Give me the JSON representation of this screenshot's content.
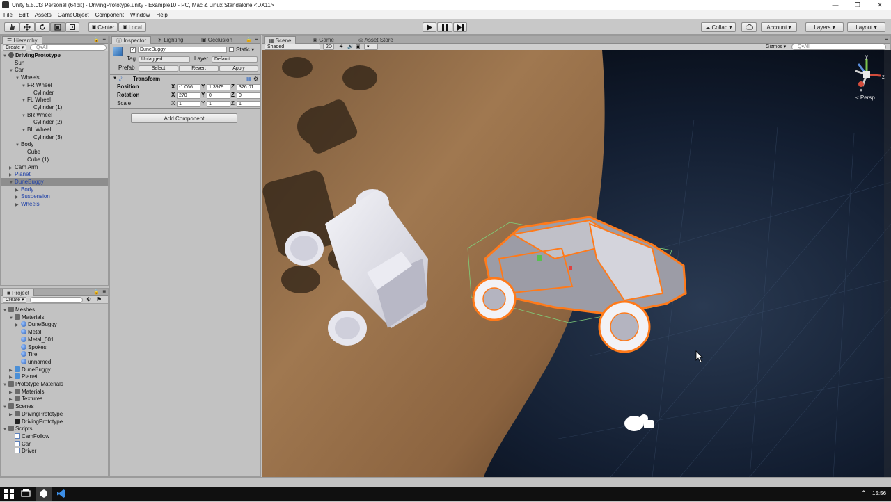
{
  "window": {
    "title": "Unity 5.5.0f3 Personal (64bit) - DrivingPrototype.unity - Example10 - PC, Mac & Linux Standalone <DX11>",
    "controls": [
      "—",
      "❐",
      "✕"
    ]
  },
  "menu": [
    "File",
    "Edit",
    "Assets",
    "GameObject",
    "Component",
    "Window",
    "Help"
  ],
  "toolbar": {
    "pivot": "Center",
    "space": "Local",
    "collab": "Collab ▾",
    "account": "Account ▾",
    "layers": "Layers ▾",
    "layout": "Layout ▾"
  },
  "hierarchy": {
    "tab": "Hierarchy",
    "create": "Create ▾",
    "search_placeholder": "Q▾All",
    "items": [
      {
        "label": "DrivingPrototype",
        "level": 0,
        "arrow": "▼",
        "style": "bold"
      },
      {
        "label": "Sun",
        "level": 1,
        "arrow": "",
        "style": ""
      },
      {
        "label": "Car",
        "level": 1,
        "arrow": "▼",
        "style": ""
      },
      {
        "label": "Wheels",
        "level": 2,
        "arrow": "▼",
        "style": ""
      },
      {
        "label": "FR Wheel",
        "level": 3,
        "arrow": "▼",
        "style": ""
      },
      {
        "label": "Cylinder",
        "level": 4,
        "arrow": "",
        "style": ""
      },
      {
        "label": "FL Wheel",
        "level": 3,
        "arrow": "▼",
        "style": ""
      },
      {
        "label": "Cylinder (1)",
        "level": 4,
        "arrow": "",
        "style": ""
      },
      {
        "label": "BR Wheel",
        "level": 3,
        "arrow": "▼",
        "style": ""
      },
      {
        "label": "Cylinder (2)",
        "level": 4,
        "arrow": "",
        "style": ""
      },
      {
        "label": "BL Wheel",
        "level": 3,
        "arrow": "▼",
        "style": ""
      },
      {
        "label": "Cylinder (3)",
        "level": 4,
        "arrow": "",
        "style": ""
      },
      {
        "label": "Body",
        "level": 2,
        "arrow": "▼",
        "style": ""
      },
      {
        "label": "Cube",
        "level": 3,
        "arrow": "",
        "style": ""
      },
      {
        "label": "Cube (1)",
        "level": 3,
        "arrow": "",
        "style": ""
      },
      {
        "label": "Cam Arm",
        "level": 1,
        "arrow": "▶",
        "style": ""
      },
      {
        "label": "Planet",
        "level": 1,
        "arrow": "▶",
        "style": "blue"
      },
      {
        "label": "DuneBuggy",
        "level": 1,
        "arrow": "▼",
        "style": "selected"
      },
      {
        "label": "Body",
        "level": 2,
        "arrow": "▶",
        "style": "blue"
      },
      {
        "label": "Suspension",
        "level": 2,
        "arrow": "▶",
        "style": "blue"
      },
      {
        "label": "Wheels",
        "level": 2,
        "arrow": "▶",
        "style": "blue"
      }
    ]
  },
  "project": {
    "tab": "Project",
    "create": "Create ▾",
    "items": [
      {
        "label": "Meshes",
        "level": 0,
        "arrow": "▼",
        "icon": "folder"
      },
      {
        "label": "Materials",
        "level": 1,
        "arrow": "▼",
        "icon": "folder"
      },
      {
        "label": "DuneBuggy",
        "level": 2,
        "arrow": "▶",
        "icon": "sphere"
      },
      {
        "label": "Metal",
        "level": 2,
        "arrow": "",
        "icon": "sphere"
      },
      {
        "label": "Metal_001",
        "level": 2,
        "arrow": "",
        "icon": "sphere"
      },
      {
        "label": "Spokes",
        "level": 2,
        "arrow": "",
        "icon": "sphere"
      },
      {
        "label": "Tire",
        "level": 2,
        "arrow": "",
        "icon": "sphere"
      },
      {
        "label": "unnamed",
        "level": 2,
        "arrow": "",
        "icon": "sphere"
      },
      {
        "label": "DuneBuggy",
        "level": 1,
        "arrow": "▶",
        "icon": "prefab"
      },
      {
        "label": "Planet",
        "level": 1,
        "arrow": "▶",
        "icon": "prefab"
      },
      {
        "label": "Prototype Materials",
        "level": 0,
        "arrow": "▼",
        "icon": "folder"
      },
      {
        "label": "Materials",
        "level": 1,
        "arrow": "▶",
        "icon": "folder"
      },
      {
        "label": "Textures",
        "level": 1,
        "arrow": "▶",
        "icon": "folder"
      },
      {
        "label": "Scenes",
        "level": 0,
        "arrow": "▼",
        "icon": "folder"
      },
      {
        "label": "DrivingPrototype",
        "level": 1,
        "arrow": "▶",
        "icon": "folder"
      },
      {
        "label": "DrivingPrototype",
        "level": 1,
        "arrow": "",
        "icon": "scene"
      },
      {
        "label": "Scripts",
        "level": 0,
        "arrow": "▼",
        "icon": "folder"
      },
      {
        "label": "CamFollow",
        "level": 1,
        "arrow": "",
        "icon": "script"
      },
      {
        "label": "Car",
        "level": 1,
        "arrow": "",
        "icon": "script"
      },
      {
        "label": "Driver",
        "level": 1,
        "arrow": "",
        "icon": "script"
      }
    ]
  },
  "inspector": {
    "tabs": [
      "Inspector",
      "Lighting",
      "Occlusion"
    ],
    "object_name": "DuneBuggy",
    "static_label": "Static ▾",
    "tag_label": "Tag",
    "tag_value": "Untagged",
    "layer_label": "Layer",
    "layer_value": "Default",
    "prefab_label": "Prefab",
    "prefab_buttons": [
      "Select",
      "Revert",
      "Apply"
    ],
    "transform_title": "Transform",
    "rows": [
      {
        "label": "Position",
        "x": "-1.066",
        "y": "1.3979",
        "z": "326.01"
      },
      {
        "label": "Rotation",
        "x": "270",
        "y": "0",
        "z": "0"
      },
      {
        "label": "Scale",
        "x": "1",
        "y": "1",
        "z": "1"
      }
    ],
    "axis": [
      "X",
      "Y",
      "Z"
    ],
    "add_component": "Add Component"
  },
  "scene": {
    "tabs": [
      "Scene",
      "Game",
      "Asset Store"
    ],
    "shading": "Shaded",
    "mode_2d": "2D",
    "gizmos": "Gizmos ▾",
    "search_placeholder": "Q▾All",
    "gizmo_labels": [
      "y",
      "z",
      "x"
    ],
    "persp": "< Persp"
  },
  "taskbar": {
    "time": "15:56",
    "tray": "⌃"
  }
}
